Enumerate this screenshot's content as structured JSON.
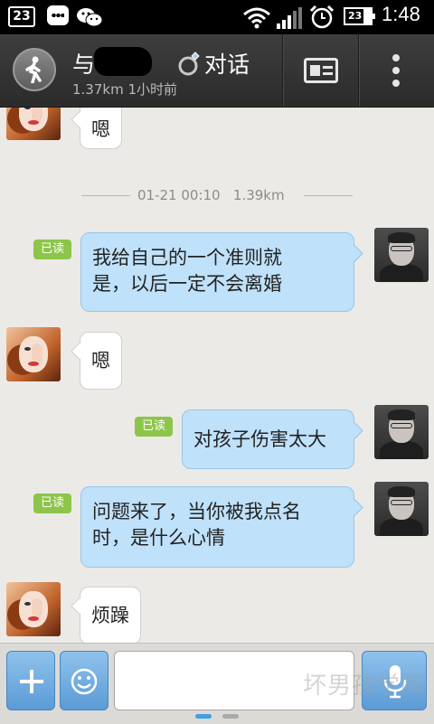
{
  "status_bar": {
    "date_badge": "23",
    "battery_level": "23",
    "time": "1:48",
    "icons": [
      "chat-notification-icon",
      "wechat-icon",
      "wifi-icon",
      "signal-icon",
      "alarm-icon",
      "battery-icon"
    ]
  },
  "header": {
    "title_prefix": "与",
    "title_suffix": "对话",
    "subtitle": "1.37km 1小时前",
    "left_button_icon": "walking-person-icon",
    "card_button_icon": "profile-card-icon",
    "menu_button_icon": "more-vertical-icon"
  },
  "messages": [
    {
      "side": "left",
      "text": "嗯"
    },
    {
      "type": "timestamp",
      "time": "01-21 00:10",
      "distance": "1.39km"
    },
    {
      "side": "right",
      "read": "已读",
      "lines": [
        "我给自己的一个准则就",
        "是，以后一定不会离婚"
      ]
    },
    {
      "side": "left",
      "text": "嗯"
    },
    {
      "side": "right",
      "read": "已读",
      "lines": [
        "对孩子伤害太大"
      ]
    },
    {
      "side": "right",
      "read": "已读",
      "lines": [
        "问题来了，当你被我点名",
        "时，是什么心情"
      ]
    },
    {
      "side": "left",
      "text": "烦躁"
    }
  ],
  "input_bar": {
    "input_value": "",
    "plus_icon": "plus-icon",
    "emoji_icon": "emoji-icon",
    "mic_icon": "microphone-icon"
  },
  "watermark": "坏男孩学院",
  "colors": {
    "read_badge": "#8cc54a",
    "outgoing_bubble": "#bfe1fa",
    "incoming_bubble": "#ffffff",
    "button_blue": "#5b9bd6"
  }
}
